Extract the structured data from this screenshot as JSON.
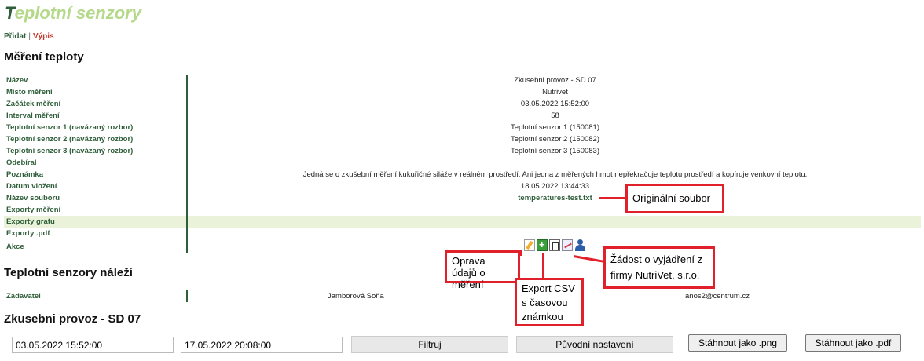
{
  "app": {
    "title_first": "T",
    "title_rest": "eplotní senzory"
  },
  "nav": {
    "add": "Přidat",
    "separator": "|",
    "list": "Výpis"
  },
  "sections": {
    "measurement": "Měření teploty",
    "belongs": "Teplotní senzory náleží",
    "graph": "Zkusebni provoz - SD 07"
  },
  "details": [
    {
      "label": "Název",
      "value": "Zkusebni provoz - SD 07"
    },
    {
      "label": "Místo měření",
      "value": "Nutrivet"
    },
    {
      "label": "Začátek měření",
      "value": "03.05.2022 15:52:00"
    },
    {
      "label": "Interval měření",
      "value": "58"
    },
    {
      "label": "Teplotní senzor 1 (navázaný rozbor)",
      "value": "Teplotní senzor 1 (150081)"
    },
    {
      "label": "Teplotní senzor 2 (navázaný rozbor)",
      "value": "Teplotní senzor 2 (150082)"
    },
    {
      "label": "Teplotní senzor 3 (navázaný rozbor)",
      "value": "Teplotní senzor 3 (150083)"
    },
    {
      "label": "Odebíral",
      "value": ""
    },
    {
      "label": "Poznámka",
      "value": "Jedná se o zkušební měření kukuřičné siláže v reálném prostředí. Ani jedna z měřených hmot nepřekračuje teplotu prostředí a kopíruje venkovní teplotu."
    },
    {
      "label": "Datum vložení",
      "value": "18.05.2022 13:44:33"
    },
    {
      "label": "Název souboru",
      "value": "temperatures-test.txt"
    },
    {
      "label": "Exporty měření",
      "value": ""
    },
    {
      "label": "Exporty grafu",
      "value": ""
    },
    {
      "label": "Exporty .pdf",
      "value": ""
    },
    {
      "label": "Akce",
      "value": ""
    }
  ],
  "icons": [
    "edit-icon",
    "export-csv-icon",
    "pdf-icon",
    "mail-icon",
    "user-icon"
  ],
  "annotations": {
    "original_file": "Originální soubor",
    "edit": "Oprava údajů o měření",
    "export_csv": "Export CSV s časovou známkou",
    "request": "Žádost o vyjádření z firmy NutriVet, s.r.o."
  },
  "assignee": {
    "label": "Zadavatel",
    "name": "Jamborová Soňa",
    "email": "anos2@centrum.cz"
  },
  "filter": {
    "from": "03.05.2022 15:52:00",
    "to": "17.05.2022 20:08:00",
    "filter_label": "Filtruj",
    "reset_label": "Původní nastavení",
    "png_label": "Stáhnout jako .png",
    "pdf_label": "Stáhnout jako .pdf"
  },
  "colors": {
    "accent": "#2f5e3a",
    "title_light": "#b5d98a",
    "highlight_row": "#eaf2da",
    "annotation": "#e0202a"
  }
}
